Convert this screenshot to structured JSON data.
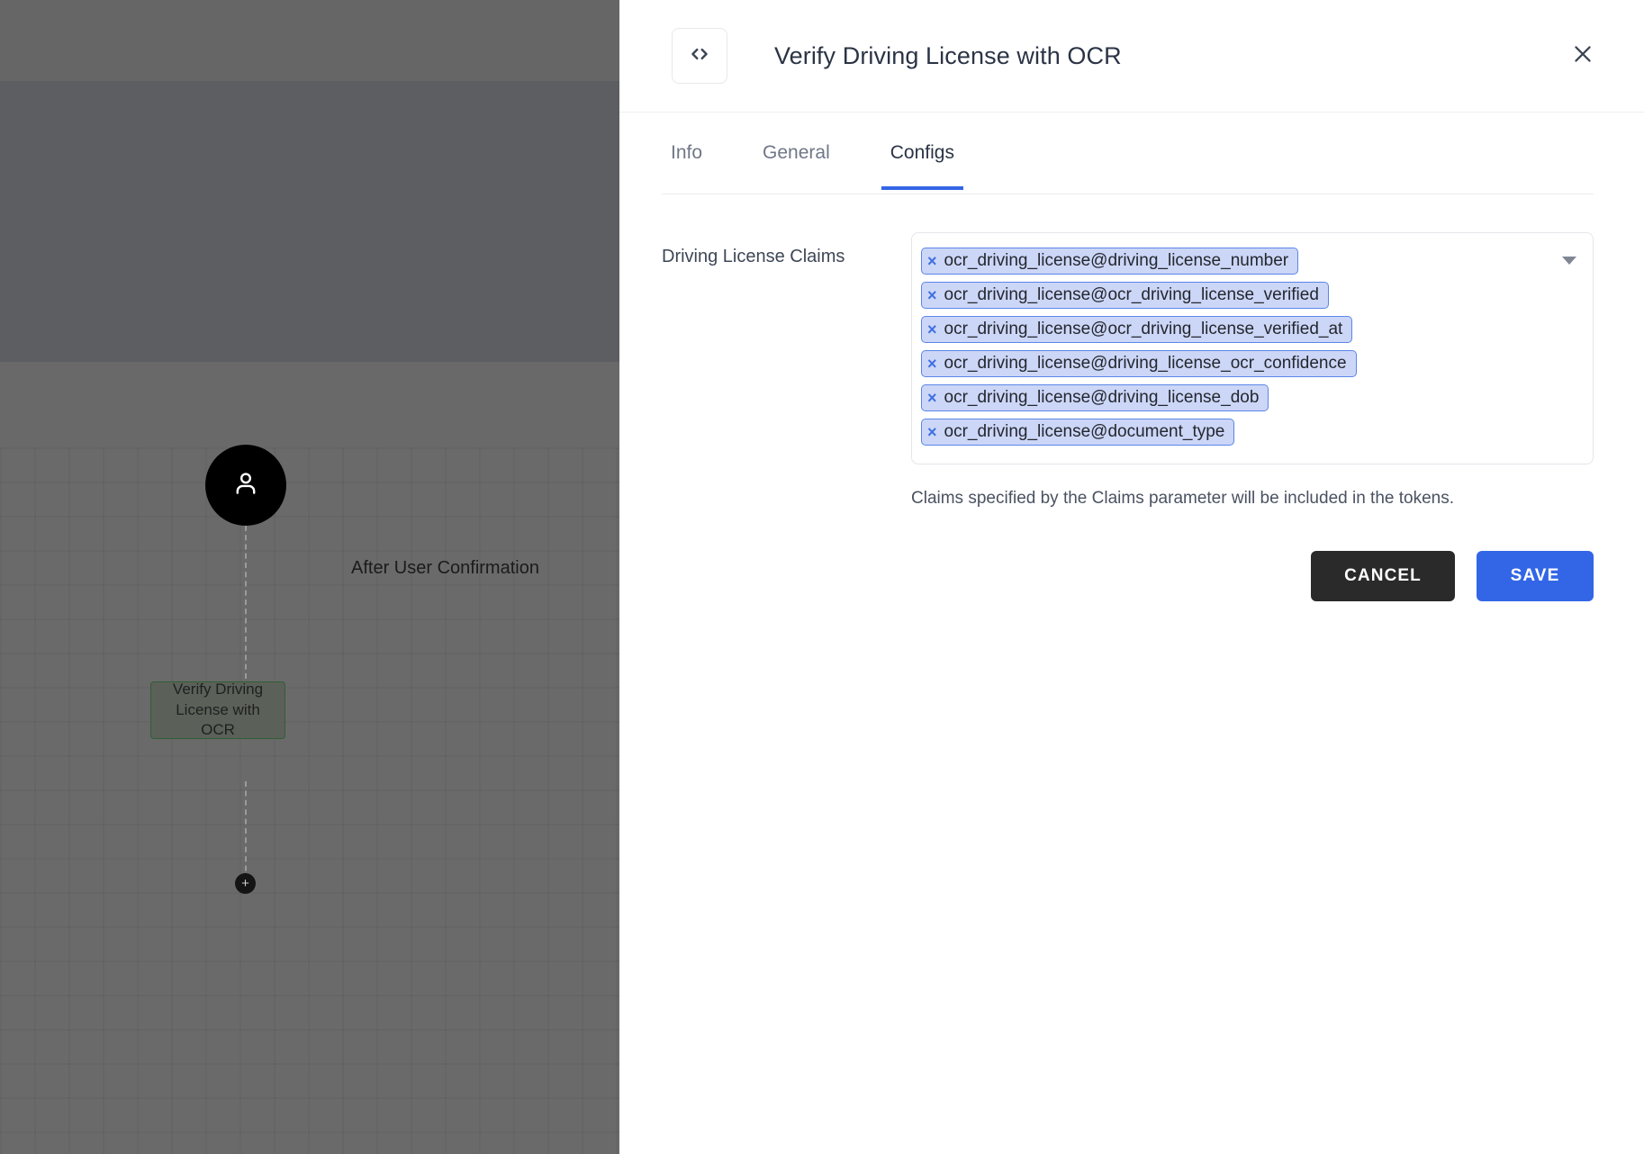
{
  "canvas": {
    "start_node": {
      "icon": "user-icon",
      "label": "After User Confirmation"
    },
    "flow_node": {
      "label": "Verify Driving License with OCR"
    },
    "add_node_button": {
      "label": "+"
    }
  },
  "dialog": {
    "code_icon": "code-brackets-icon",
    "title": "Verify Driving License with OCR",
    "close_icon": "close-icon",
    "tabs": [
      {
        "label": "Info",
        "active": false
      },
      {
        "label": "General",
        "active": false
      },
      {
        "label": "Configs",
        "active": true
      }
    ],
    "field": {
      "label": "Driving License Claims",
      "chips": [
        "ocr_driving_license@driving_license_number",
        "ocr_driving_license@ocr_driving_license_verified",
        "ocr_driving_license@ocr_driving_license_verified_at",
        "ocr_driving_license@driving_license_ocr_confidence",
        "ocr_driving_license@driving_license_dob",
        "ocr_driving_license@document_type"
      ],
      "chip_remove_glyph": "×",
      "caret_icon": "chevron-down-icon",
      "hint": "Claims specified by the Claims parameter will be included in the tokens."
    },
    "actions": {
      "cancel_label": "CANCEL",
      "save_label": "SAVE"
    }
  },
  "colors": {
    "accent": "#3366e6",
    "chip_bg": "#ccd6f7",
    "chip_border": "#5b86e8",
    "cancel_bg": "#2a2a2a",
    "node_border": "#2f5e33"
  }
}
